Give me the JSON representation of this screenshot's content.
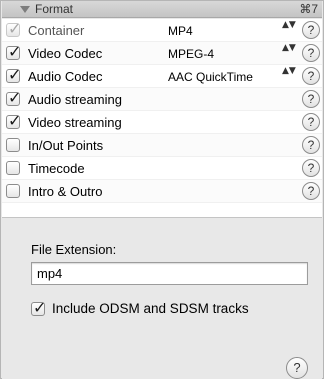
{
  "header": {
    "title": "Format",
    "shortcut": "⌘7"
  },
  "options": [
    {
      "label": "Container",
      "value": "MP4",
      "checked": true,
      "disabled": true,
      "has_popup": true
    },
    {
      "label": "Video Codec",
      "value": "MPEG-4",
      "checked": true,
      "disabled": false,
      "has_popup": true
    },
    {
      "label": "Audio Codec",
      "value": "AAC QuickTime",
      "checked": true,
      "disabled": false,
      "has_popup": true
    },
    {
      "label": "Audio streaming",
      "value": "",
      "checked": true,
      "disabled": false,
      "has_popup": false
    },
    {
      "label": "Video streaming",
      "value": "",
      "checked": true,
      "disabled": false,
      "has_popup": false
    },
    {
      "label": "In/Out Points",
      "value": "",
      "checked": false,
      "disabled": false,
      "has_popup": false
    },
    {
      "label": "Timecode",
      "value": "",
      "checked": false,
      "disabled": false,
      "has_popup": false
    },
    {
      "label": "Intro & Outro",
      "value": "",
      "checked": false,
      "disabled": false,
      "has_popup": false
    }
  ],
  "help_glyph": "?",
  "check_glyph": "✓",
  "stepper_glyph": "▲▼",
  "extension": {
    "label": "File Extension:",
    "value": "mp4"
  },
  "odsm": {
    "label": "Include ODSM and SDSM tracks",
    "checked": true
  },
  "icons": {
    "disclosure": "disclosure-triangle-icon",
    "help": "help-icon",
    "stepper": "popup-stepper-icon",
    "check": "checkmark-icon"
  }
}
